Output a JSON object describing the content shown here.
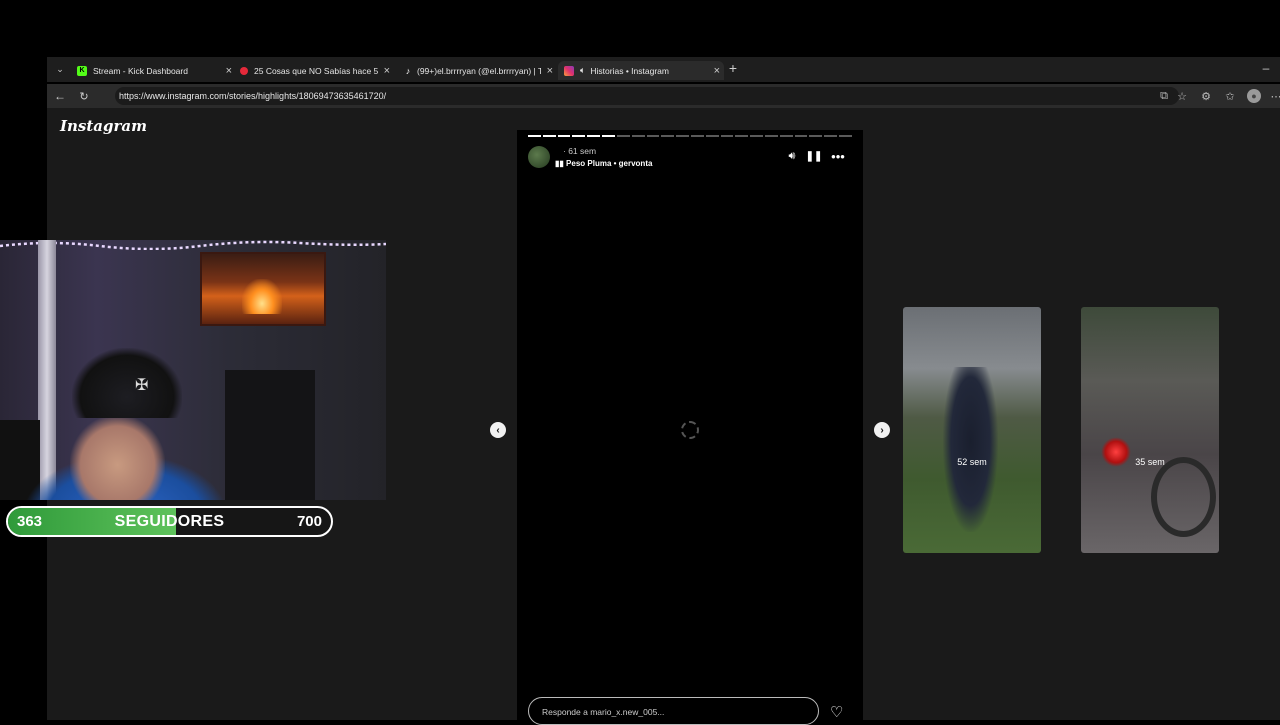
{
  "browser": {
    "tabs": [
      {
        "title": "Stream - Kick Dashboard",
        "favicon": "kick-icon",
        "color": "#53fc18"
      },
      {
        "title": "25 Cosas que NO Sabías hace 5 m",
        "favicon": "youtube-icon",
        "color": "#e5293a"
      },
      {
        "title": "(99+)el.brrrryan (@el.brrrryan) | Ti",
        "favicon": "tiktok-icon",
        "color": "#ffffff"
      },
      {
        "title": "Historias • Instagram",
        "favicon": "instagram-icon",
        "color": "#e1306c",
        "active": true
      }
    ],
    "new_tab": "+",
    "url": "https://www.instagram.com/stories/highlights/18069473635461720/",
    "minimize": "–"
  },
  "instagram": {
    "logo": "Instagram",
    "story": {
      "time": "61 sem",
      "music": "Peso Pluma • gervonta",
      "segments_total": 22,
      "segments_done": 6,
      "reply_placeholder": "Responde a mario_x.new_005..."
    },
    "thumbnails": [
      {
        "label": "52 sem"
      },
      {
        "label": "35 sem"
      }
    ]
  },
  "overlay": {
    "followers_current": "363",
    "followers_label": "SEGUIDORES",
    "followers_goal": "700",
    "progress_fraction": 0.52
  },
  "colors": {
    "accent_green": "#4cb64f",
    "page_bg": "#1a1a1a"
  }
}
